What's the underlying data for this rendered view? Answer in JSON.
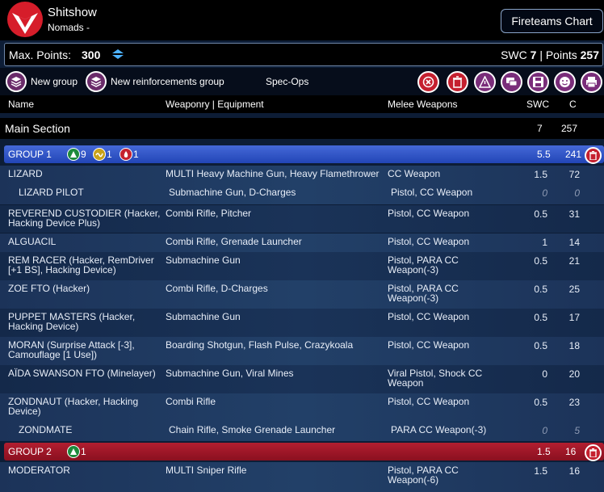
{
  "app": {
    "title": "Shitshow",
    "subtitle": "Nomads -",
    "fireteams_button": "Fireteams Chart"
  },
  "points": {
    "label": "Max. Points:",
    "value": "300",
    "swc_label": "SWC",
    "swc_value": "7",
    "points_label": "| Points",
    "points_value": "257"
  },
  "toolbar": {
    "new_group": "New group",
    "new_reinforcements_group": "New reinforcements group",
    "spec_ops": "Spec-Ops"
  },
  "columns": {
    "name": "Name",
    "weaponry": "Weaponry | Equipment",
    "melee": "Melee Weapons",
    "swc": "SWC",
    "cost": "C"
  },
  "main_section": {
    "title": "Main Section",
    "swc": "7",
    "points": "257"
  },
  "groups": [
    {
      "name": "GROUP 1",
      "swc": "5.5",
      "points": "241",
      "badges": [
        {
          "icon": "regular-order-icon",
          "count": "9"
        },
        {
          "icon": "irregular-order-icon",
          "count": "1"
        },
        {
          "icon": "impetuous-order-icon",
          "count": "1"
        }
      ]
    },
    {
      "name": "GROUP 2",
      "swc": "1.5",
      "points": "16",
      "badges": [
        {
          "icon": "regular-order-icon",
          "count": "1"
        }
      ]
    }
  ],
  "rows": [
    {
      "name": "LIZARD",
      "weapons": "MULTI Heavy Machine Gun, Heavy Flamethrower",
      "melee": "CC Weapon",
      "swc": "1.5",
      "pts": "72"
    },
    {
      "name": "LIZARD PILOT",
      "weapons": "Submachine Gun, D-Charges",
      "melee": "Pistol, CC Weapon",
      "swc": "0",
      "pts": "0"
    },
    {
      "name": "REVEREND CUSTODIER (Hacker, Hacking Device Plus)",
      "weapons": "Combi Rifle, Pitcher",
      "melee": "Pistol, CC Weapon",
      "swc": "0.5",
      "pts": "31"
    },
    {
      "name": "ALGUACIL",
      "weapons": "Combi Rifle, Grenade Launcher",
      "melee": "Pistol, CC Weapon",
      "swc": "1",
      "pts": "14"
    },
    {
      "name": "REM RACER (Hacker, RemDriver [+1 BS], Hacking Device)",
      "weapons": "Submachine Gun",
      "melee": "Pistol, PARA CC Weapon(-3)",
      "swc": "0.5",
      "pts": "21"
    },
    {
      "name": "ZOE FTO (Hacker)",
      "weapons": "Combi Rifle, D-Charges",
      "melee": "Pistol, PARA CC Weapon(-3)",
      "swc": "0.5",
      "pts": "25"
    },
    {
      "name": "PUPPET MASTERS (Hacker, Hacking Device)",
      "weapons": "Submachine Gun",
      "melee": "Pistol, CC Weapon",
      "swc": "0.5",
      "pts": "17"
    },
    {
      "name": "MORAN (Surprise Attack [-3], Camouflage [1 Use])",
      "weapons": "Boarding Shotgun, Flash Pulse, Crazykoala",
      "melee": "Pistol, CC Weapon",
      "swc": "0.5",
      "pts": "18"
    },
    {
      "name": "AÏDA SWANSON FTO (Minelayer)",
      "weapons": "Submachine Gun, Viral Mines",
      "melee": "Viral Pistol, Shock CC Weapon",
      "swc": "0",
      "pts": "20"
    },
    {
      "name": "ZONDNAUT (Hacker, Hacking Device)",
      "weapons": "Combi Rifle",
      "melee": "Pistol, CC Weapon",
      "swc": "0.5",
      "pts": "23"
    },
    {
      "name": "ZONDMATE",
      "weapons": "Chain Rifle, Smoke Grenade Launcher",
      "melee": "PARA CC Weapon(-3)",
      "swc": "0",
      "pts": "5"
    },
    {
      "name": "MODERATOR",
      "weapons": "MULTI Sniper Rifle",
      "melee": "Pistol, PARA CC Weapon(-6)",
      "swc": "1.5",
      "pts": "16"
    }
  ],
  "colors": {
    "header_bg": "#000000",
    "group1": "#2f55c8",
    "group2": "#a01828",
    "row_bg": "#1c3359",
    "logo_red": "#d61d2a"
  },
  "icons": [
    "faction-logo-icon",
    "points-stepper-icon",
    "new-group-icon",
    "new-reinforcements-icon",
    "close-icon",
    "trash-icon",
    "warning-icon",
    "chat-icon",
    "save-icon",
    "face-icon",
    "print-icon",
    "delete-group-icon"
  ]
}
